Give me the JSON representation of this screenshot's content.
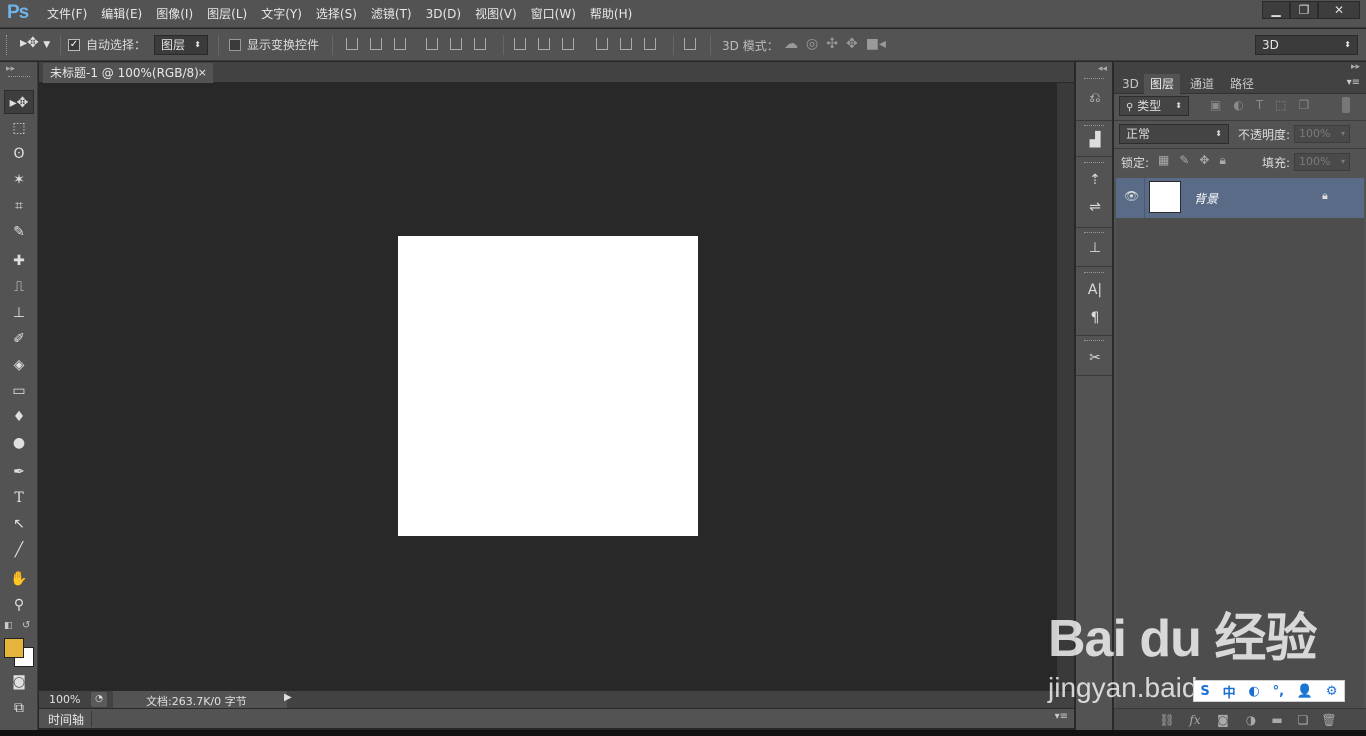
{
  "app": {
    "logo": "Ps"
  },
  "menu": [
    "文件(F)",
    "编辑(E)",
    "图像(I)",
    "图层(L)",
    "文字(Y)",
    "选择(S)",
    "滤镜(T)",
    "3D(D)",
    "视图(V)",
    "窗口(W)",
    "帮助(H)"
  ],
  "window_controls": {
    "minimize": "▁",
    "restore": "❐",
    "close": "✕"
  },
  "options": {
    "auto_select_label": "自动选择：",
    "auto_select_value": "图层",
    "show_transform_label": "显示变换控件",
    "mode_3d_label": "3D 模式：",
    "workspace_value": "3D"
  },
  "document": {
    "tab_title": "未标题-1 @ 100%(RGB/8)",
    "tab_close": "×",
    "zoom": "100%",
    "doc_info": "文档:263.7K/0 字节",
    "timeline_label": "时间轴"
  },
  "colors": {
    "foreground": "#e8b53c",
    "background": "#ffffff",
    "layer_selected": "#596b86"
  },
  "tools": [
    "move-tool",
    "marquee-tool",
    "lasso-tool",
    "magic-wand-tool",
    "crop-tool",
    "eyedropper-tool",
    "healing-tool",
    "brush-tool",
    "stamp-tool",
    "history-brush-tool",
    "eraser-tool",
    "gradient-tool",
    "blur-tool",
    "dodge-tool",
    "pen-tool",
    "type-tool",
    "path-select-tool",
    "line-tool",
    "hand-tool",
    "zoom-tool"
  ],
  "tool_glyphs": {
    "move": "▸✥",
    "marquee": "⬚",
    "lasso": "ʘ",
    "wand": "✶",
    "crop": "⌗",
    "eyedropper": "✎",
    "healing": "✚",
    "brush": "⎍",
    "stamp": "⊥",
    "history": "✐",
    "eraser": "◈",
    "gradient": "▭",
    "blur": "♦",
    "dodge": "●",
    "pen": "✒",
    "type": "T",
    "pathselect": "↖",
    "line": "╱",
    "hand": "✋",
    "zoom": "⚲",
    "quickmask": "◙",
    "screenmode": "⧉"
  },
  "layers_panel": {
    "tabs": [
      "3D",
      "图层",
      "通道",
      "路径"
    ],
    "filter_kind": "类型",
    "blend_mode": "正常",
    "opacity_label": "不透明度:",
    "opacity_value": "100%",
    "lock_label": "锁定:",
    "fill_label": "填充:",
    "fill_value": "100%",
    "layers": [
      {
        "name": "背景",
        "visible": true,
        "locked": true
      }
    ]
  },
  "layer_footer_icons": [
    "link-icon",
    "fx-icon",
    "mask-icon",
    "adjustment-icon",
    "folder-icon",
    "new-layer-icon",
    "trash-icon"
  ],
  "watermark": {
    "brand": "Bai du 经验",
    "url": "jingyan.baidu.com"
  },
  "ime_bar": [
    "S",
    "中",
    "◐",
    "°,",
    "👤",
    "⚙"
  ]
}
